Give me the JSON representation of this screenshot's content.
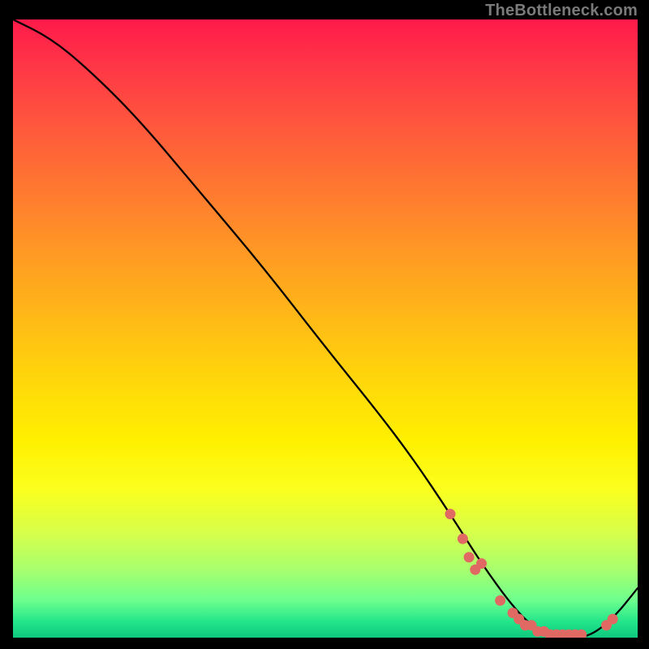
{
  "attribution": "TheBottleneck.com",
  "chart_data": {
    "type": "line",
    "title": "",
    "xlabel": "",
    "ylabel": "",
    "xlim": [
      0,
      100
    ],
    "ylim": [
      0,
      100
    ],
    "series": [
      {
        "name": "curve",
        "x": [
          0,
          6,
          12,
          20,
          30,
          40,
          50,
          58,
          64,
          70,
          75,
          80,
          84,
          88,
          92,
          96,
          100
        ],
        "y": [
          100,
          97,
          92,
          84,
          72,
          60,
          47,
          37,
          29,
          20,
          12,
          5,
          1,
          0,
          0,
          3,
          8
        ]
      }
    ],
    "marker_cluster": {
      "name": "dots",
      "points": [
        {
          "x": 70,
          "y": 20
        },
        {
          "x": 72,
          "y": 16
        },
        {
          "x": 73,
          "y": 13
        },
        {
          "x": 74,
          "y": 11
        },
        {
          "x": 75,
          "y": 12
        },
        {
          "x": 78,
          "y": 6
        },
        {
          "x": 80,
          "y": 4
        },
        {
          "x": 81,
          "y": 3
        },
        {
          "x": 82,
          "y": 2
        },
        {
          "x": 83,
          "y": 2
        },
        {
          "x": 84,
          "y": 1
        },
        {
          "x": 85,
          "y": 1
        },
        {
          "x": 86,
          "y": 0.5
        },
        {
          "x": 87,
          "y": 0.5
        },
        {
          "x": 88,
          "y": 0.5
        },
        {
          "x": 89,
          "y": 0.5
        },
        {
          "x": 90,
          "y": 0.5
        },
        {
          "x": 91,
          "y": 0.5
        },
        {
          "x": 95,
          "y": 2
        },
        {
          "x": 96,
          "y": 3
        }
      ]
    },
    "colors": {
      "curve": "#000000",
      "markers": "#e06a63",
      "gradient_top": "#ff1a4b",
      "gradient_mid": "#fff000",
      "gradient_bottom": "#0fc97e"
    }
  }
}
